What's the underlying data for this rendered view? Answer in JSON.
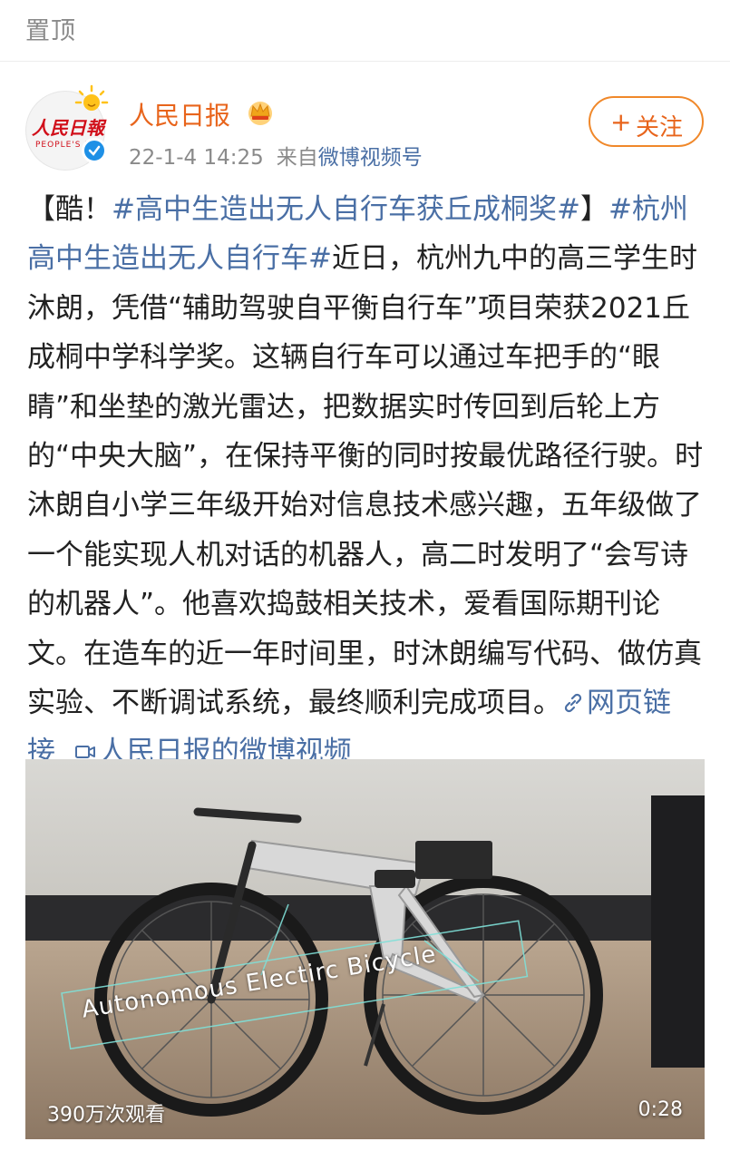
{
  "pinned": {
    "label": "置顶"
  },
  "author": {
    "name": "人民日报",
    "avatar_text": "人民日報",
    "avatar_sub": "PEOPLE'S DA",
    "time": "22-1-4 14:25",
    "source_prefix": "来自",
    "source": "微博视频号"
  },
  "follow": {
    "plus": "+",
    "label": "关注"
  },
  "post": {
    "bracket_open": "【酷！",
    "hashtag_1": "#高中生造出无人自行车获丘成桐奖#",
    "bracket_close": "】",
    "hashtag_2": "#杭州高中生造出无人自行车#",
    "text": "近日，杭州九中的高三学生时沐朗，凭借“辅助驾驶自平衡自行车”项目荣获2021丘成桐中学科学奖。这辆自行车可以通过车把手的“眼睛”和坐垫的激光雷达，把数据实时传回到后轮上方的“中央大脑”，在保持平衡的同时按最优路径行驶。时沐朗自小学三年级开始对信息技术感兴趣，五年级做了一个能实现人机对话的机器人，高二时发明了“会写诗的机器人”。他喜欢捣鼓相关技术，爱看国际期刊论文。在造车的近一年时间里，时沐朗编写代码、做仿真实验、不断调试系统，最终顺利完成项目。",
    "web_link": "网页链接",
    "video_link": "人民日报的微博视频"
  },
  "video": {
    "caption": "Autonomous Electirc Bicycle",
    "views": "390万次观看",
    "duration": "0:28"
  },
  "colors": {
    "accent": "#e8641b",
    "link": "#4a6fa5",
    "muted": "#8a8a8a"
  }
}
